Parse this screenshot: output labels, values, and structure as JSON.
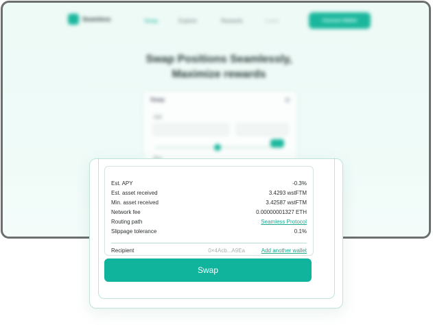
{
  "background": {
    "nav": {
      "brand": "Seamless",
      "items": [
        "Swap",
        "Explore",
        "Rewards",
        "Learn"
      ],
      "cta": "Connect Wallet"
    },
    "hero": {
      "line1": "Swap Positions Seamlessly,",
      "line2": "Maximize rewards"
    },
    "card": {
      "title": "Swap",
      "from_label": "Sell",
      "to_label": "Buy"
    }
  },
  "details": {
    "rows": [
      {
        "label": "Est. APY",
        "value": "-0.3%"
      },
      {
        "label": "Est. asset received",
        "value": "3.4293 wstFTM"
      },
      {
        "label": "Min. asset received",
        "value": "3.42587 wstFTM"
      },
      {
        "label": "Network fee",
        "value": "0.00000001327 ETH"
      },
      {
        "label": "Routing path",
        "value": "Seamless Protocol"
      },
      {
        "label": "Slippage tolerance",
        "value": "0.1%"
      }
    ],
    "recipient": {
      "label": "Recipient",
      "address": "0×4Acb...A9Ea",
      "add_link": "Add another wallet"
    }
  },
  "swap_button": "Swap",
  "colors": {
    "accent": "#10b39b",
    "link": "#1aa98f",
    "border": "#bfe3da",
    "window_frame": "#6b6f6e"
  }
}
